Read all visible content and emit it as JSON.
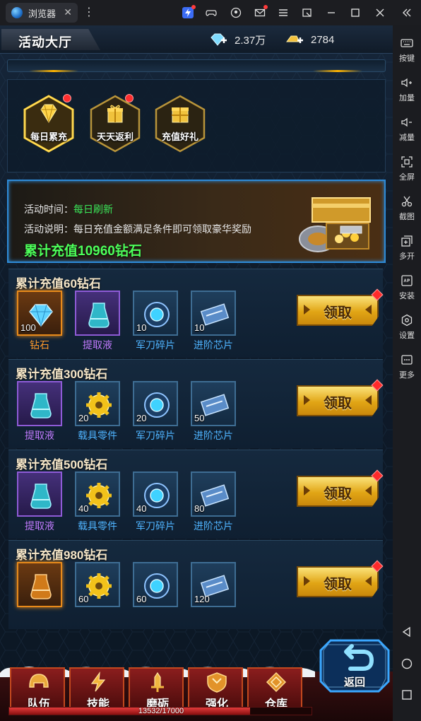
{
  "browser": {
    "tab_title": "浏览器",
    "tab_close": "✕",
    "more_glyph": "⋮"
  },
  "sidebar": {
    "items": [
      {
        "label": "按键",
        "icon": "keyboard-icon"
      },
      {
        "label": "加量",
        "icon": "volume-up-icon"
      },
      {
        "label": "减量",
        "icon": "volume-down-icon"
      },
      {
        "label": "全屏",
        "icon": "fullscreen-icon"
      },
      {
        "label": "截图",
        "icon": "scissors-icon"
      },
      {
        "label": "多开",
        "icon": "multi-instance-icon"
      },
      {
        "label": "安装",
        "icon": "apk-install-icon"
      },
      {
        "label": "设置",
        "icon": "settings-icon"
      },
      {
        "label": "更多",
        "icon": "more-icon"
      }
    ]
  },
  "game": {
    "title": "活动大厅",
    "currency": {
      "diamond_value": "2.37万",
      "gold_value": "2784"
    },
    "categories": [
      {
        "label": "每日累充",
        "selected": true,
        "badge": true
      },
      {
        "label": "天天返利",
        "selected": false,
        "badge": true
      },
      {
        "label": "充值好礼",
        "selected": false,
        "badge": false
      }
    ],
    "banner": {
      "time_label": "活动时间：",
      "time_value": "每日刷新",
      "desc_label": "活动说明：",
      "desc_value": "每日充值金额满足条件即可领取豪华奖励",
      "total": "累计充值10960钻石"
    },
    "tiers": [
      {
        "title": "累计充值60钻石",
        "claim_label": "领取",
        "items": [
          {
            "name": "钻石",
            "count": "100",
            "quality": "orange",
            "name_color": "#ff9a2a",
            "art": "diamond"
          },
          {
            "name": "提取液",
            "count": "",
            "quality": "purple",
            "name_color": "#c27bff",
            "art": "vial"
          },
          {
            "name": "军刀碎片",
            "count": "10",
            "quality": "blue",
            "name_color": "#4fb4ff",
            "art": "orb"
          },
          {
            "name": "进阶芯片",
            "count": "10",
            "quality": "blue",
            "name_color": "#4fb4ff",
            "art": "chip"
          }
        ]
      },
      {
        "title": "累计充值300钻石",
        "claim_label": "领取",
        "items": [
          {
            "name": "提取液",
            "count": "",
            "quality": "purple",
            "name_color": "#c27bff",
            "art": "vial"
          },
          {
            "name": "载具零件",
            "count": "20",
            "quality": "blue",
            "name_color": "#4fb4ff",
            "art": "gear"
          },
          {
            "name": "军刀碎片",
            "count": "20",
            "quality": "blue",
            "name_color": "#4fb4ff",
            "art": "orb"
          },
          {
            "name": "进阶芯片",
            "count": "50",
            "quality": "blue",
            "name_color": "#4fb4ff",
            "art": "chip"
          }
        ]
      },
      {
        "title": "累计充值500钻石",
        "claim_label": "领取",
        "items": [
          {
            "name": "提取液",
            "count": "",
            "quality": "purple",
            "name_color": "#c27bff",
            "art": "vial"
          },
          {
            "name": "载具零件",
            "count": "40",
            "quality": "blue",
            "name_color": "#4fb4ff",
            "art": "gear"
          },
          {
            "name": "军刀碎片",
            "count": "40",
            "quality": "blue",
            "name_color": "#4fb4ff",
            "art": "orb"
          },
          {
            "name": "进阶芯片",
            "count": "80",
            "quality": "blue",
            "name_color": "#4fb4ff",
            "art": "chip"
          }
        ]
      },
      {
        "title": "累计充值980钻石",
        "claim_label": "领取",
        "items": [
          {
            "name": "",
            "count": "",
            "quality": "orange",
            "name_color": "#ff9a2a",
            "art": "orange-vial"
          },
          {
            "name": "",
            "count": "60",
            "quality": "blue",
            "name_color": "#4fb4ff",
            "art": "gear"
          },
          {
            "name": "",
            "count": "60",
            "quality": "blue",
            "name_color": "#4fb4ff",
            "art": "orb"
          },
          {
            "name": "",
            "count": "120",
            "quality": "blue",
            "name_color": "#4fb4ff",
            "art": "chip"
          }
        ]
      }
    ],
    "bottom_nav": [
      {
        "label": "队伍",
        "icon": "helmet-icon"
      },
      {
        "label": "技能",
        "icon": "lightning-icon"
      },
      {
        "label": "磨砺",
        "icon": "sword-icon"
      },
      {
        "label": "强化",
        "icon": "shield-icon"
      },
      {
        "label": "仓库",
        "icon": "crate-icon"
      }
    ],
    "progress": {
      "text": "13532/17000",
      "fraction": 0.796
    },
    "back_label": "返回"
  }
}
